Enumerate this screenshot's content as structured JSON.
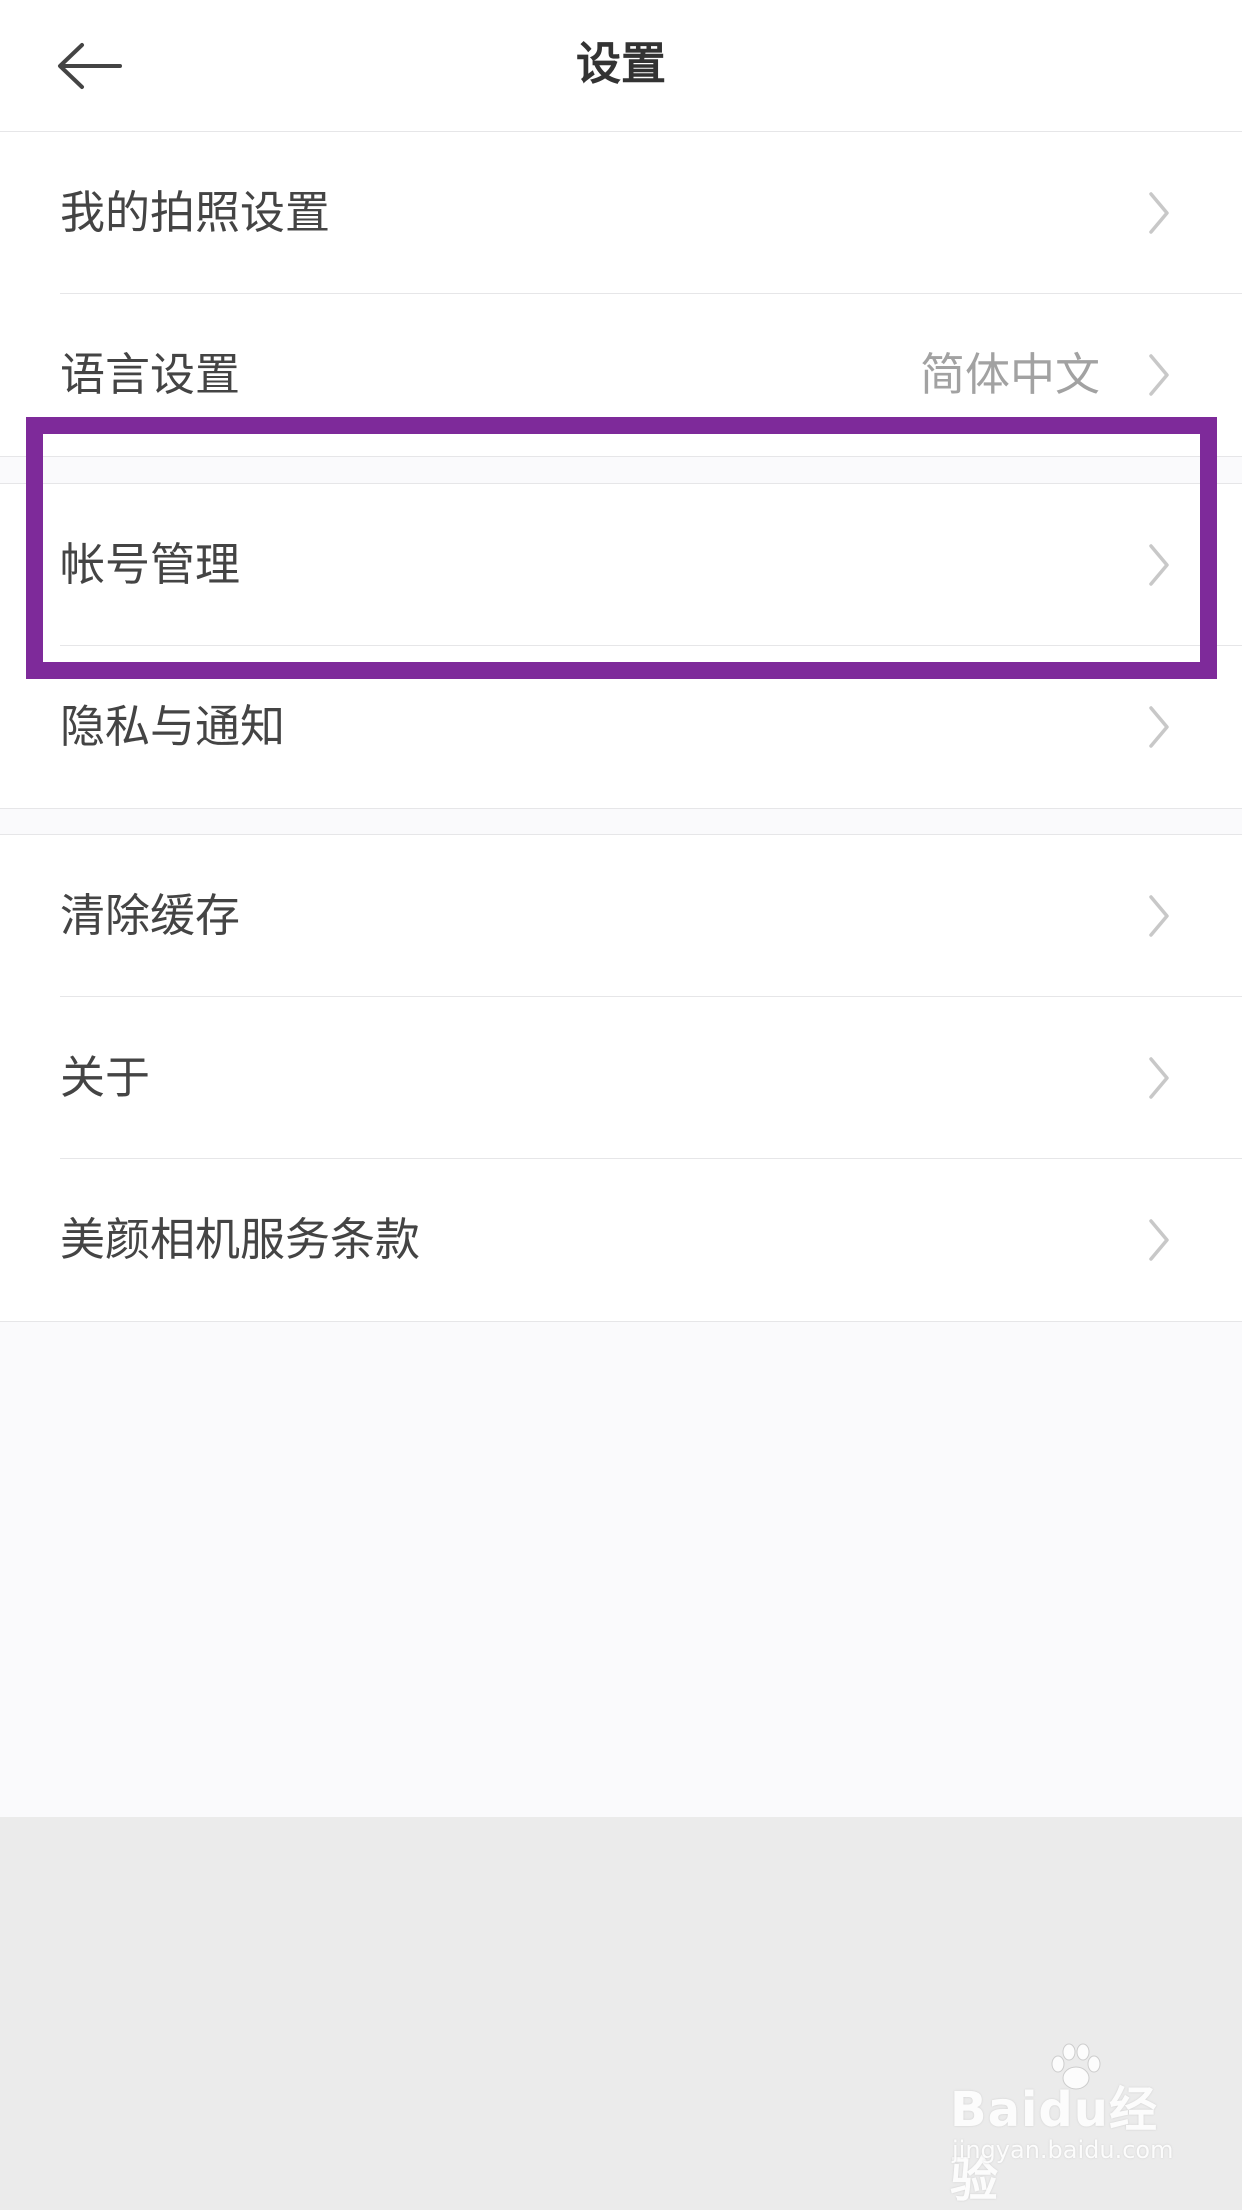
{
  "header": {
    "title": "设置"
  },
  "groups": [
    {
      "items": [
        {
          "label": "我的拍照设置",
          "value": ""
        },
        {
          "label": "语言设置",
          "value": "简体中文"
        }
      ]
    },
    {
      "items": [
        {
          "label": "帐号管理",
          "value": ""
        },
        {
          "label": "隐私与通知",
          "value": ""
        }
      ]
    },
    {
      "items": [
        {
          "label": "清除缓存",
          "value": ""
        },
        {
          "label": "关于",
          "value": ""
        },
        {
          "label": "美颜相机服务条款",
          "value": ""
        }
      ]
    }
  ],
  "watermark": {
    "main": "Baidu经验",
    "sub": "jingyan.baidu.com"
  },
  "colors": {
    "highlight": "#7e2a9a",
    "page_bg": "#fafafc",
    "bottom_bg": "#ebebeb"
  },
  "icons": {
    "back": "arrow-left-icon",
    "row_chevron": "chevron-right-icon"
  }
}
